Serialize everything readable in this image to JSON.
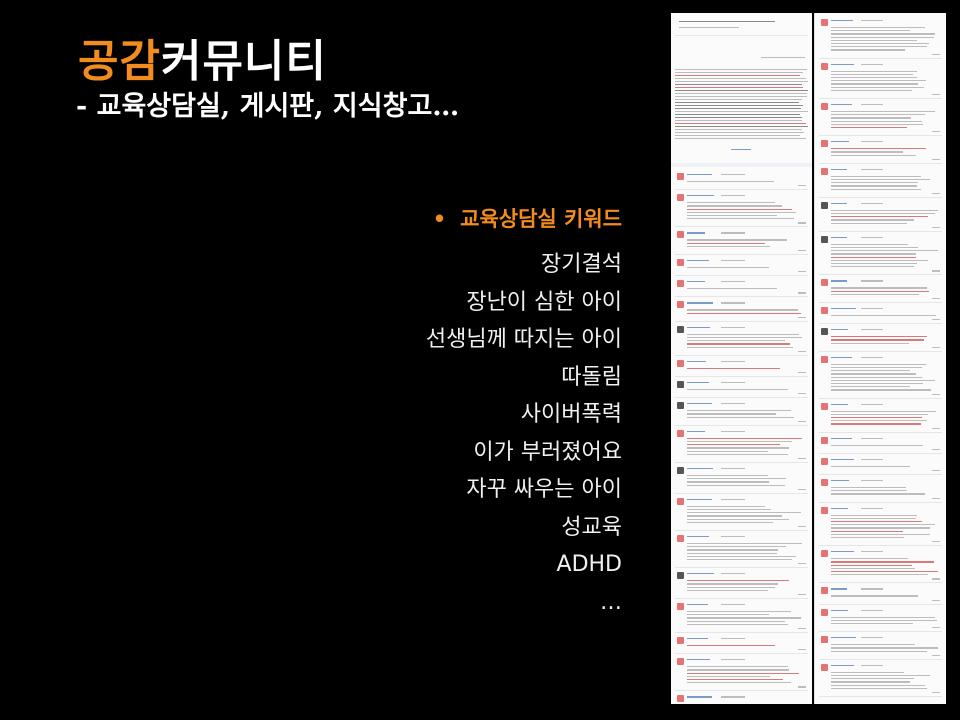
{
  "slide": {
    "title_accent": "공감",
    "title_rest": "커뮤니티",
    "subtitle": "- 교육상담실, 게시판, 지식창고…"
  },
  "keywords": {
    "bullet": "•",
    "heading": "교육상담실 키워드",
    "items": [
      "장기결석",
      "장난이 심한 아이",
      "선생님께 따지는 아이",
      "따돌림",
      "사이버폭력",
      "이가 부러졌어요",
      "자꾸 싸우는 아이",
      "성교육",
      "ADHD",
      "…"
    ]
  },
  "colors": {
    "background": "#000000",
    "accent": "#f28c1f",
    "text": "#ffffff"
  }
}
